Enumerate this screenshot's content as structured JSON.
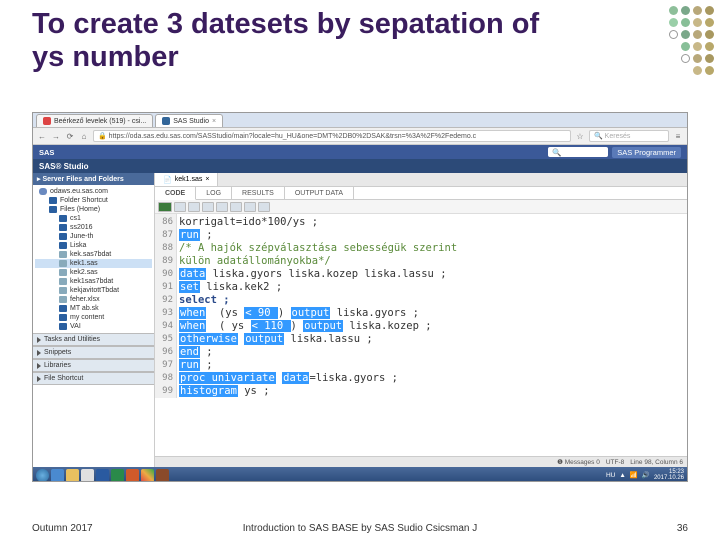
{
  "slide": {
    "title": "To create 3 datesets by sepatation of ys number"
  },
  "browser": {
    "tabs": [
      {
        "label": "Beérkező levelek (519) - csi..."
      },
      {
        "label": "SAS Studio"
      }
    ],
    "addr": "https://oda.sas.edu.sas.com/SASStudio/main?locale=hu_HU&one=DMT%2DB0%2DSAK&trsn=%3A%2F%2Fedemo.c",
    "search_placeholder": "Keresés"
  },
  "sas_top": {
    "left": "SAS",
    "right_btn": "SAS Programmer"
  },
  "studio": {
    "label": "SAS® Studio"
  },
  "sidebar": {
    "header": "Server Files and Folders",
    "items": [
      {
        "label": "odaws.eu.sas.com",
        "cls": "cloud",
        "lvl": 0
      },
      {
        "label": "Folder Shortcut",
        "cls": "folder-o",
        "lvl": 1
      },
      {
        "label": "Files (Home)",
        "cls": "folder-o",
        "lvl": 1
      },
      {
        "label": "cs1",
        "cls": "folder-o",
        "lvl": 2
      },
      {
        "label": "ss2016",
        "cls": "folder-o",
        "lvl": 2
      },
      {
        "label": "June-th",
        "cls": "folder-o",
        "lvl": 2
      },
      {
        "label": "Liska",
        "cls": "folder-o",
        "lvl": 2
      },
      {
        "label": "kek.sas7bdat",
        "cls": "file",
        "lvl": 2
      },
      {
        "label": "kek1.sas",
        "cls": "file",
        "lvl": 2,
        "sel": true
      },
      {
        "label": "kek2.sas",
        "cls": "file",
        "lvl": 2
      },
      {
        "label": "kek1sas7bdat",
        "cls": "file",
        "lvl": 2
      },
      {
        "label": "kekjavitottTbdat",
        "cls": "file",
        "lvl": 2
      },
      {
        "label": "feher.xlsx",
        "cls": "file",
        "lvl": 2
      },
      {
        "label": "MT ab.sk",
        "cls": "folder-o",
        "lvl": 2
      },
      {
        "label": "my content",
        "cls": "folder-o",
        "lvl": 2
      },
      {
        "label": "VAI",
        "cls": "folder-o",
        "lvl": 2
      }
    ],
    "sections": [
      "Tasks and Utilities",
      "Snippets",
      "Libraries",
      "File Shortcut"
    ]
  },
  "main": {
    "file_tab": "kek1.sas",
    "sub_tabs": [
      "CODE",
      "LOG",
      "RESULTS",
      "OUTPUT DATA"
    ],
    "gutter": [
      "86",
      "87",
      "88",
      "89",
      "90",
      "91",
      "92",
      "93",
      "94",
      "95",
      "96",
      "97",
      "98",
      "99"
    ],
    "statusbar": {
      "messages": "Messages 0",
      "enc": "UTF-8",
      "pos": "Line 98, Column 6"
    },
    "code": {
      "l86a": "korrigalt=ido*100/ys ;",
      "l87a": "run",
      "l87b": " ;",
      "l88a": "/* A hajók szépválasztása sebességük szerint",
      "l89a": "külön adatállományokba*/",
      "l90a": "data",
      "l90b": " liska.gyors liska.kozep liska.lassu ;",
      "l91a": "set",
      "l91b": " liska.kek2 ;",
      "l92a": "select ;",
      "l93a": "when",
      "l93b": "  (ys ",
      "l93c": "< 90 ",
      "l93d": ") ",
      "l93e": "output",
      "l93f": " liska.gyors ;",
      "l94a": "when",
      "l94b": "  ( ys ",
      "l94c": "< 110 ",
      "l94d": ") ",
      "l94e": "output",
      "l94f": " liska.kozep ;",
      "l95a": "otherwise",
      "l95b": " ",
      "l95c": "output",
      "l95d": " liska.lassu ;",
      "l96a": "end",
      "l96b": " ;",
      "l97a": "run",
      "l97b": " ;",
      "l98a": "proc univariate",
      "l98b": " ",
      "l98c": "data",
      "l98d": "=liska.gyors ;",
      "l99a": "histogram",
      "l99b": " ys ;"
    }
  },
  "taskbar": {
    "lang": "HU",
    "time": "15:23",
    "date": "2017.10.26"
  },
  "footer": {
    "left": "Outumn 2017",
    "center": "Introduction to SAS BASE by SAS Sudio Csicsman J",
    "right": "36"
  }
}
